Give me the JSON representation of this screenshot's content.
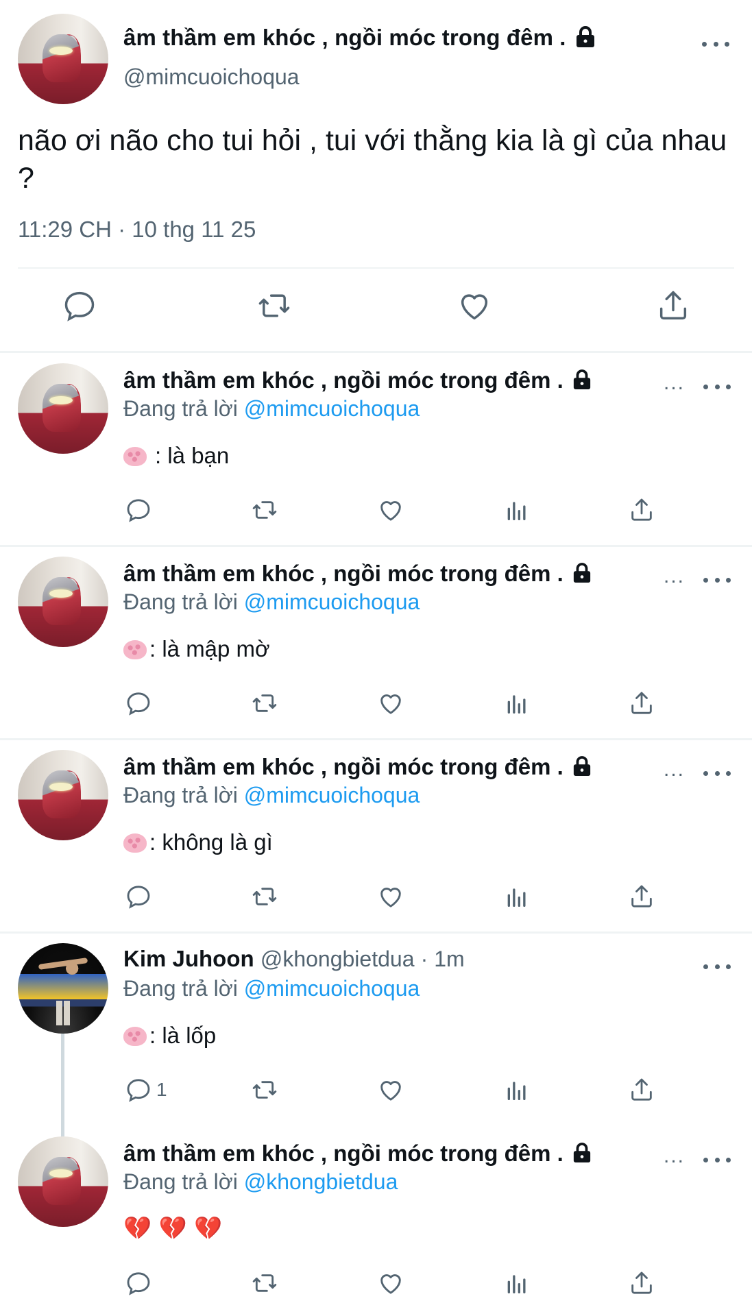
{
  "main_tweet": {
    "display_name": "âm thầm em khóc , ngồi móc trong đêm .",
    "handle": "@mimcuoichoqua",
    "text": "não ơi não cho tui hỏi , tui với thằng kia là gì của nhau ?",
    "timestamp": "11:29 CH · 10 thg 11 25"
  },
  "replying_label": "Đang trả lời",
  "truncation": "...",
  "replies": [
    {
      "display_name": "âm thầm em khóc , ngồi móc trong đêm .",
      "reply_to": "@mimcuoichoqua",
      "text": ": là bạn"
    },
    {
      "display_name": "âm thầm em khóc , ngồi móc trong đêm .",
      "reply_to": "@mimcuoichoqua",
      "text": ": là mập mờ"
    },
    {
      "display_name": "âm thầm em khóc , ngồi móc trong đêm .",
      "reply_to": "@mimcuoichoqua",
      "text": ": không là gì"
    },
    {
      "display_name": "Kim Juhoon",
      "handle": "@khongbietdua",
      "time": "· 1m",
      "reply_to": "@mimcuoichoqua",
      "text": ": là lốp",
      "reply_count": "1"
    },
    {
      "display_name": "âm thầm em khóc , ngồi móc trong đêm .",
      "reply_to": "@khongbietdua",
      "text": "💔 💔 💔"
    }
  ],
  "colors": {
    "text": "#0f1419",
    "secondary": "#536471",
    "link": "#1d9bf0",
    "divider": "#eff3f4"
  },
  "icons": [
    "lock-icon",
    "more-icon",
    "reply-icon",
    "retweet-icon",
    "like-icon",
    "share-icon",
    "views-icon",
    "brain-emoji",
    "broken-heart-emoji"
  ]
}
